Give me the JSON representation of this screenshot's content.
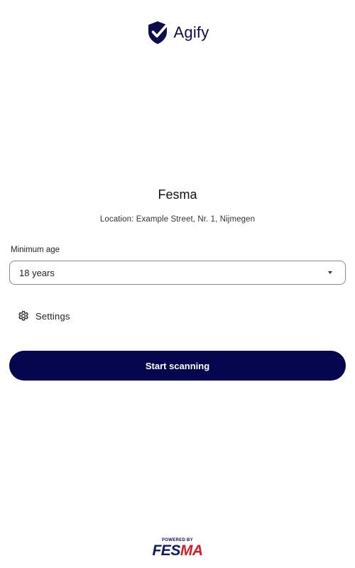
{
  "header": {
    "logo_text": "Agify",
    "brand_color": "#0c0c4e"
  },
  "venue": {
    "name": "Fesma",
    "location": "Location: Example Street, Nr. 1, Nijmegen"
  },
  "minimum_age": {
    "label": "Minimum age",
    "selected_value": "18 years"
  },
  "settings": {
    "label": "Settings",
    "icon": "gear-icon"
  },
  "actions": {
    "start_label": "Start scanning",
    "button_color": "#06064f"
  },
  "footer": {
    "powered_by": "POWERED BY",
    "brand_part1": "FES",
    "brand_part2": "MA",
    "brand_colors": [
      "#0c1a5e",
      "#d51d26"
    ]
  }
}
